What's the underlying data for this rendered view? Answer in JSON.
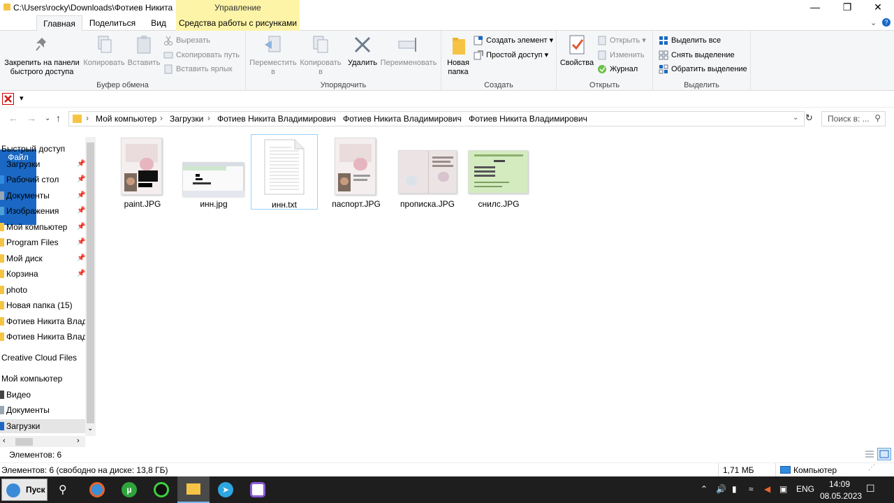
{
  "window": {
    "title": "C:\\Users\\rocky\\Downloads\\Фотиев Никита ...",
    "context_tab_header": "Управление"
  },
  "tabs": {
    "file": "Файл",
    "home": "Главная",
    "share": "Поделиться",
    "view": "Вид",
    "picture_tools": "Средства работы с рисунками"
  },
  "ribbon": {
    "clipboard": {
      "label": "Буфер обмена",
      "pin": "Закрепить на панели быстрого доступа",
      "copy": "Копировать",
      "paste": "Вставить",
      "cut": "Вырезать",
      "copy_path": "Скопировать путь",
      "paste_shortcut": "Вставить ярлык"
    },
    "organize": {
      "label": "Упорядочить",
      "move_to": "Переместить в",
      "copy_to": "Копировать в",
      "delete": "Удалить",
      "rename": "Переименовать"
    },
    "create": {
      "label": "Создать",
      "new_folder": "Новая папка",
      "new_item": "Создать элемент",
      "easy_access": "Простой доступ"
    },
    "open": {
      "label": "Открыть",
      "properties": "Свойства",
      "open": "Открыть",
      "edit": "Изменить",
      "history": "Журнал"
    },
    "select": {
      "label": "Выделить",
      "select_all": "Выделить все",
      "select_none": "Снять выделение",
      "invert": "Обратить выделение"
    }
  },
  "address": {
    "crumbs": [
      "Мой компьютер",
      "Загрузки",
      "Фотиев Никита Владимирович",
      "Фотиев Никита Владимирович",
      "Фотиев Никита Владимирович"
    ],
    "search_placeholder": "Поиск в: ..."
  },
  "sidebar": {
    "quick_access": "Быстрый доступ",
    "items": [
      {
        "label": "Загрузки",
        "pinned": true
      },
      {
        "label": "Рабочий стол",
        "pinned": true
      },
      {
        "label": "Документы",
        "pinned": true
      },
      {
        "label": "Изображения",
        "pinned": true
      },
      {
        "label": "Мой компьютер",
        "pinned": true
      },
      {
        "label": "Program Files",
        "pinned": true
      },
      {
        "label": "Мой диск",
        "pinned": true
      },
      {
        "label": "Корзина",
        "pinned": true
      },
      {
        "label": "photo",
        "pinned": false
      },
      {
        "label": "Новая папка (15)",
        "pinned": false
      },
      {
        "label": "Фотиев Никита Владимирович",
        "pinned": false
      },
      {
        "label": "Фотиев Никита Владимирович",
        "pinned": false
      }
    ],
    "creative_cloud": "Creative Cloud Files",
    "my_computer": "Мой компьютер",
    "pc_items": [
      {
        "label": "Видео"
      },
      {
        "label": "Документы"
      },
      {
        "label": "Загрузки"
      }
    ]
  },
  "files": [
    {
      "name": "paint.JPG",
      "kind": "passport-scan"
    },
    {
      "name": "инн.jpg",
      "kind": "screenshot"
    },
    {
      "name": "инн.txt",
      "kind": "text-document"
    },
    {
      "name": "паспорт.JPG",
      "kind": "passport-scan"
    },
    {
      "name": "прописка.JPG",
      "kind": "registration-scan"
    },
    {
      "name": "снилс.JPG",
      "kind": "snils-card"
    }
  ],
  "status": {
    "items_count": "Элементов: 6",
    "details": "Элементов: 6 (свободно на диске: 13,8 ГБ)",
    "size": "1,71 МБ",
    "location": "Компьютер"
  },
  "taskbar": {
    "start": "Пуск",
    "language": "ENG",
    "time": "14:09",
    "date": "08.05.2023"
  },
  "colors": {
    "accent": "#1a68c4",
    "context_tab": "#fdf4a8",
    "folder": "#f6c444",
    "selection": "#99d1ff",
    "taskbar": "#1e1e1e"
  }
}
